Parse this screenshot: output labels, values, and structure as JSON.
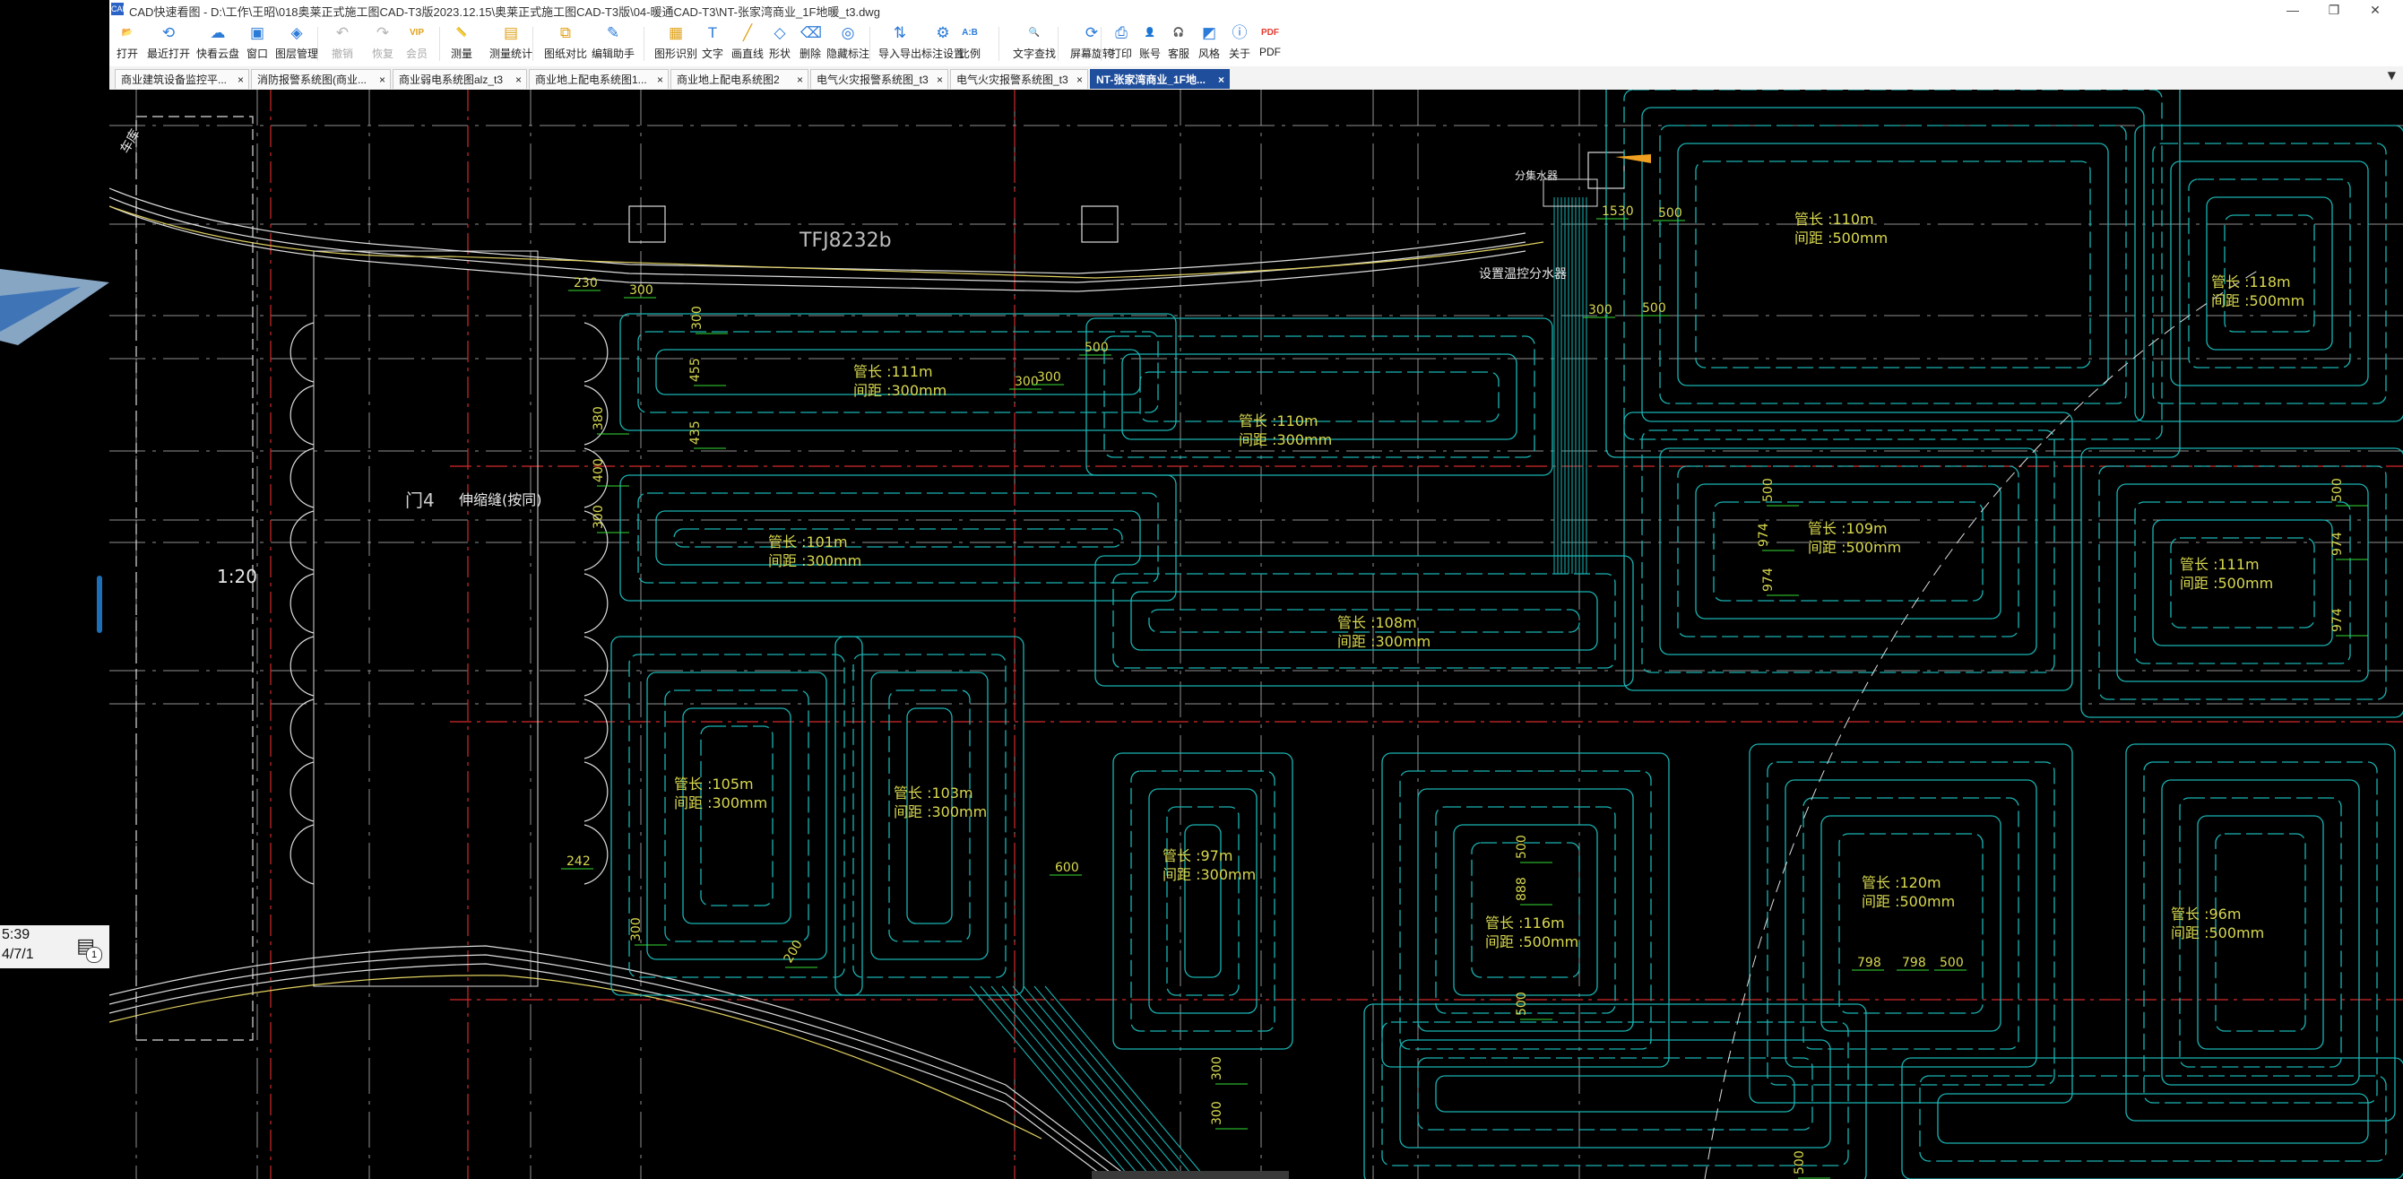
{
  "window": {
    "app_icon": "CAD",
    "title": "CAD快速看图 - D:\\工作\\王昭\\018奥莱正式施工图CAD-T3版2023.12.15\\奥莱正式施工图CAD-T3版\\04-暖通CAD-T3\\NT-张家湾商业_1F地暖_t3.dwg",
    "controls": {
      "minimize": "—",
      "maximize": "❐",
      "close": "✕"
    }
  },
  "desktop": {
    "time": "5:39",
    "date": "4/7/1",
    "notification_icon": "message-icon",
    "notification_count": "1"
  },
  "toolbar": {
    "items": [
      {
        "label": "打开",
        "icon": "folder-open-icon",
        "glyph": "📂",
        "color": "#2b7bd8"
      },
      {
        "label": "最近打开",
        "icon": "history-icon",
        "glyph": "⟲",
        "color": "#2b7bd8"
      },
      {
        "label": "快看云盘",
        "icon": "cloud-icon",
        "glyph": "☁",
        "color": "#2b7bd8"
      },
      {
        "label": "窗口",
        "icon": "window-icon",
        "glyph": "▣",
        "color": "#2b7bd8"
      },
      {
        "label": "图层管理",
        "icon": "layers-icon",
        "glyph": "◈",
        "color": "#2b7bd8"
      },
      {
        "label": "撤销",
        "icon": "undo-icon",
        "glyph": "↶",
        "color": "#b5b5b5",
        "disabled": true
      },
      {
        "label": "恢复",
        "icon": "redo-icon",
        "glyph": "↷",
        "color": "#b5b5b5",
        "disabled": true
      },
      {
        "label": "会员",
        "icon": "vip-icon",
        "glyph": "VIP",
        "color": "#e0a21a",
        "disabled": true
      },
      {
        "label": "测量",
        "icon": "measure-icon",
        "glyph": "📏",
        "color": "#2b7bd8"
      },
      {
        "label": "测量统计",
        "icon": "measure-stats-icon",
        "glyph": "▤",
        "color": "#e0a21a"
      },
      {
        "label": "图纸对比",
        "icon": "compare-icon",
        "glyph": "⧉",
        "color": "#e0a21a"
      },
      {
        "label": "编辑助手",
        "icon": "edit-assistant-icon",
        "glyph": "✎",
        "color": "#2b7bd8"
      },
      {
        "label": "图形识别",
        "icon": "shape-recognize-icon",
        "glyph": "▦",
        "color": "#e0a21a"
      },
      {
        "label": "文字",
        "icon": "text-icon",
        "glyph": "T",
        "color": "#2b7bd8"
      },
      {
        "label": "画直线",
        "icon": "line-icon",
        "glyph": "╱",
        "color": "#e0a21a"
      },
      {
        "label": "形状",
        "icon": "shape-icon",
        "glyph": "◇",
        "color": "#2b7bd8"
      },
      {
        "label": "删除",
        "icon": "eraser-icon",
        "glyph": "⌫",
        "color": "#2b7bd8"
      },
      {
        "label": "隐藏标注",
        "icon": "hide-annotation-icon",
        "glyph": "◎",
        "color": "#2b7bd8"
      },
      {
        "label": "导入导出",
        "icon": "import-export-icon",
        "glyph": "⇅",
        "color": "#2b7bd8"
      },
      {
        "label": "标注设置",
        "icon": "annotation-settings-icon",
        "glyph": "⚙",
        "color": "#2b7bd8"
      },
      {
        "label": "比例",
        "icon": "scale-icon",
        "glyph": "A:B",
        "color": "#2b7bd8"
      },
      {
        "label": "文字查找",
        "icon": "text-search-icon",
        "glyph": "🔍",
        "color": "#2b7bd8"
      },
      {
        "label": "屏幕旋转",
        "icon": "rotate-screen-icon",
        "glyph": "⟳",
        "color": "#2b7bd8"
      },
      {
        "label": "打印",
        "icon": "printer-icon",
        "glyph": "⎙",
        "color": "#2b7bd8"
      },
      {
        "label": "账号",
        "icon": "account-icon",
        "glyph": "👤",
        "color": "#2b7bd8"
      },
      {
        "label": "客服",
        "icon": "headset-icon",
        "glyph": "🎧",
        "color": "#2b7bd8"
      },
      {
        "label": "风格",
        "icon": "style-icon",
        "glyph": "◩",
        "color": "#2b7bd8"
      },
      {
        "label": "关于",
        "icon": "info-icon",
        "glyph": "ⓘ",
        "color": "#2b7bd8"
      },
      {
        "label": "PDF",
        "icon": "pdf-icon",
        "glyph": "PDF",
        "color": "#e23b2e"
      }
    ]
  },
  "tabs": [
    {
      "label": "商业建筑设备监控平..."
    },
    {
      "label": "消防报警系统图(商业..."
    },
    {
      "label": "商业弱电系统图alz_t3"
    },
    {
      "label": "商业地上配电系统图1..."
    },
    {
      "label": "商业地上配电系统图2"
    },
    {
      "label": "电气火灾报警系统图_t3"
    },
    {
      "label": "电气火灾报警系统图_t3"
    },
    {
      "label": "NT-张家湾商业_1F地..."
    }
  ],
  "tab_close_glyph": "×",
  "tab_menu_glyph": "▼",
  "drawing": {
    "colors": {
      "pipe": "#19b4b4",
      "dimension": "#33dd33",
      "text": "#d8d850",
      "grid": "#cfcfcf",
      "wall": "#dcdcdc",
      "red_axis": "#d22a2a"
    },
    "labels": {
      "beam": "TFJ8232b",
      "room": "门4",
      "note": "伸缩缝(按同)",
      "scale": "1:20",
      "manifold": "分集水器",
      "valve": "设置温控分水器",
      "ramp": "车库"
    },
    "loops": [
      {
        "length": "管长 :111m",
        "spacing": "间距 :300mm"
      },
      {
        "length": "管长 :110m",
        "spacing": "间距 :300mm"
      },
      {
        "length": "管长 :101m",
        "spacing": "间距 :300mm"
      },
      {
        "length": "管长 :108m",
        "spacing": "间距 :300mm"
      },
      {
        "length": "管长 :105m",
        "spacing": "间距 :300mm"
      },
      {
        "length": "管长 :103m",
        "spacing": "间距 :300mm"
      },
      {
        "length": "管长 :97m",
        "spacing": "间距 :300mm"
      },
      {
        "length": "管长 :116m",
        "spacing": "间距 :500mm"
      },
      {
        "length": "管长 :120m",
        "spacing": "间距 :500mm"
      },
      {
        "length": "管长 :96m",
        "spacing": "间距 :500mm"
      },
      {
        "length": "管长 :110m",
        "spacing": "间距 :500mm"
      },
      {
        "length": "管长 :118m",
        "spacing": "间距 :500mm"
      },
      {
        "length": "管长 :109m",
        "spacing": "间距 :500mm"
      },
      {
        "length": "管长 :111m",
        "spacing": "间距 :500mm"
      }
    ],
    "dims": [
      "230",
      "300",
      "300",
      "455",
      "435",
      "380",
      "400",
      "300",
      "300",
      "500",
      "300",
      "1530",
      "500",
      "300",
      "500",
      "500",
      "974",
      "974",
      "500",
      "974",
      "974",
      "500",
      "888",
      "500",
      "798",
      "798",
      "500",
      "600",
      "242",
      "300",
      "200",
      "300",
      "300",
      "500"
    ]
  }
}
